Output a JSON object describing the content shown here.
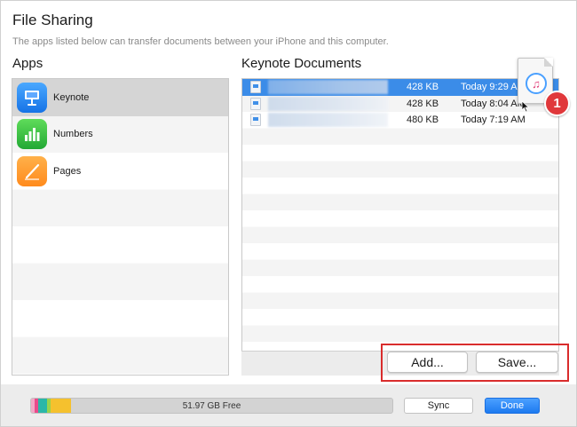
{
  "header": {
    "title": "File Sharing",
    "subtitle": "The apps listed below can transfer documents between your iPhone and this computer."
  },
  "apps": {
    "heading": "Apps",
    "items": [
      {
        "label": "Keynote",
        "icon": "keynote-icon",
        "selected": true
      },
      {
        "label": "Numbers",
        "icon": "numbers-icon",
        "selected": false
      },
      {
        "label": "Pages",
        "icon": "pages-icon",
        "selected": false
      }
    ]
  },
  "documents": {
    "heading": "Keynote Documents",
    "rows": [
      {
        "size": "428 KB",
        "date": "Today 9:29 AM",
        "selected": true
      },
      {
        "size": "428 KB",
        "date": "Today 8:04 AM",
        "selected": false
      },
      {
        "size": "480 KB",
        "date": "Today 7:19 AM",
        "selected": false
      }
    ]
  },
  "actions": {
    "add_label": "Add...",
    "save_label": "Save..."
  },
  "drag": {
    "badge_count": "1",
    "icon": "itunes-music-icon"
  },
  "footer": {
    "storage_label": "51.97 GB Free",
    "storage_segments": [
      {
        "color": "#f2a8c6",
        "fraction": 0.01
      },
      {
        "color": "#e94c8b",
        "fraction": 0.01
      },
      {
        "color": "#2bb7a8",
        "fraction": 0.025
      },
      {
        "color": "#9ad34b",
        "fraction": 0.01
      },
      {
        "color": "#f5c12e",
        "fraction": 0.055
      }
    ],
    "sync_label": "Sync",
    "done_label": "Done"
  },
  "colors": {
    "selection_blue": "#3b8ce8",
    "highlight_red": "#d92c2c",
    "done_blue": "#1d7af0"
  }
}
